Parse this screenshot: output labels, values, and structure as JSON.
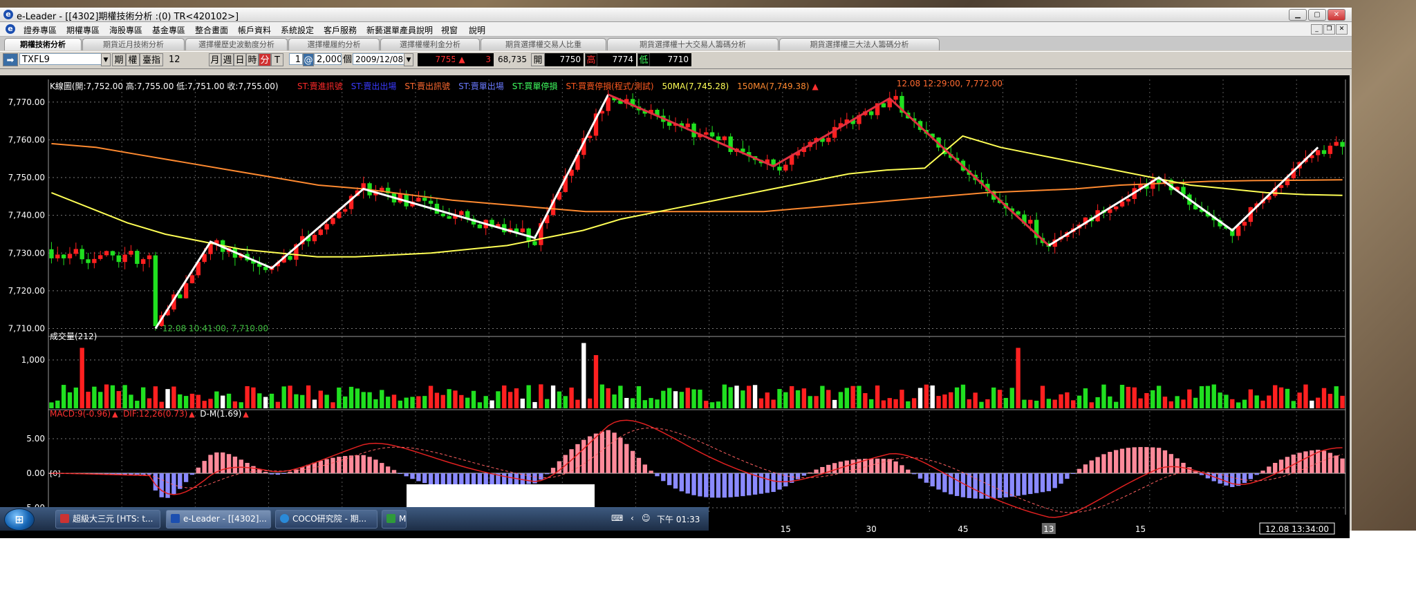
{
  "window": {
    "title": "e-Leader - [[4302]期權技術分析 :(0) TR<420102>]"
  },
  "window_controls": {
    "minimize": "▁",
    "maximize": "▢",
    "close": "✕"
  },
  "menu": {
    "items": [
      "證券專區",
      "期權專區",
      "海股專區",
      "基金專區",
      "整合畫面",
      "帳戶資料",
      "系統設定",
      "客戶服務",
      "新藝選單產員說明",
      "視窗",
      "說明"
    ]
  },
  "mdi_controls": {
    "minimize": "_",
    "restore": "❐",
    "close": "✕"
  },
  "tabs": [
    "期權技術分析",
    "期貨近月技術分析",
    "選擇權歷史波動度分析",
    "選擇權履約分析",
    "選擇權權利金分析",
    "期貨選擇權交易人比重",
    "期貨選擇權十大交易人籌碼分析",
    "期貨選擇權三大法人籌碼分析"
  ],
  "toolbar": {
    "symbol": "TXFL9",
    "btn_futures": "期",
    "btn_options": "權",
    "btn_index": "臺指",
    "period_value": "12",
    "period_month": "月",
    "period_week": "週",
    "period_day": "日",
    "period_hour": "時",
    "period_minute": "分",
    "btn_t": "T",
    "multiplier": "1",
    "at_sign": "@",
    "count": "2,000",
    "count_unit": "個",
    "date": "2009/12/08",
    "last_price": "7755",
    "change_arrow": "▲",
    "change": "3",
    "volume": "68,735",
    "open_label": "開",
    "open": "7750",
    "high_label": "高",
    "high": "7774",
    "low_label": "低",
    "low": "7710"
  },
  "chart_data": [
    {
      "type": "candlestick",
      "title": "K線圖(開:7,752.00 高:7,755.00 低:7,751.00 收:7,755.00)",
      "legend": [
        {
          "label": "ST:賣進訊號",
          "color": "#ff2a2a"
        },
        {
          "label": "ST:賣出出場",
          "color": "#3a3aff"
        },
        {
          "label": "ST:賣出訊號",
          "color": "#ff6a30"
        },
        {
          "label": "ST:賣單出場",
          "color": "#6a7aff"
        },
        {
          "label": "ST:買單停損",
          "color": "#40ff60"
        },
        {
          "label": "ST:買賣停損(程式/測試)",
          "color": "#ff5a20"
        },
        {
          "label": "50MA(7,745.28)",
          "color": "#ffff55"
        },
        {
          "label": "150MA(7,749.38)",
          "color": "#ff8a30"
        }
      ],
      "legend_arrow": "▲",
      "y_ticks": [
        7770,
        7760,
        7750,
        7740,
        7730,
        7720,
        7710
      ],
      "y_tick_labels": [
        "7,770.00",
        "7,760.00",
        "7,750.00",
        "7,740.00",
        "7,730.00",
        "7,720.00",
        "7,710.00"
      ],
      "ylim": [
        7709,
        7776
      ],
      "n_bars": 212,
      "ma50": [
        7746,
        7742,
        7738,
        7735,
        7733,
        7731,
        7730,
        7729,
        7729,
        7729.5,
        7730,
        7731,
        7732,
        7734,
        7736,
        7739,
        7741,
        7743,
        7745,
        7747,
        7749,
        7751,
        7752,
        7752.5,
        7761,
        7758,
        7756,
        7754,
        7752,
        7750,
        7748,
        7747,
        7746,
        7745.5,
        7745.3
      ],
      "ma150": [
        7759,
        7758,
        7756,
        7754,
        7752,
        7750,
        7748,
        7747,
        7745.5,
        7744,
        7743,
        7742,
        7741,
        7741,
        7741,
        7741,
        7741,
        7742,
        7743,
        7744,
        7745,
        7746,
        7746.5,
        7747,
        7748,
        7748.5,
        7749,
        7749.2,
        7749.3,
        7749.4
      ],
      "zigzag": [
        {
          "color": "#ffffff",
          "points": [
            [
              17,
              7710
            ],
            [
              26,
              7733
            ],
            [
              36,
              7726
            ],
            [
              51,
              7747
            ],
            [
              79,
              7734
            ],
            [
              91,
              7772
            ]
          ]
        },
        {
          "color": "#e03040",
          "points": [
            [
              91,
              7772
            ],
            [
              118,
              7753
            ],
            [
              137,
              7771
            ],
            [
              163,
              7732
            ]
          ]
        },
        {
          "color": "#ffffff",
          "points": [
            [
              163,
              7732
            ],
            [
              181,
              7750
            ],
            [
              193,
              7736
            ],
            [
              207,
              7758
            ]
          ]
        }
      ],
      "annotations": [
        {
          "text": "12.08 12:29:00, 7,772.00",
          "x": 137,
          "y": 7772,
          "color": "#ff6a30"
        },
        {
          "text": "12.08 10:41:00, 7,710.00",
          "x": 17,
          "y": 7710,
          "color": "#40c040"
        }
      ]
    },
    {
      "type": "bar",
      "title": "成交量(212)",
      "y_ticks": [
        1000
      ],
      "y_tick_labels": [
        "1,000"
      ],
      "ylim": [
        0,
        1400
      ],
      "spike_bars": [
        {
          "index": 5,
          "value": 1250
        },
        {
          "index": 87,
          "value": 1350
        },
        {
          "index": 89,
          "value": 1100
        },
        {
          "index": 158,
          "value": 1250
        }
      ]
    },
    {
      "type": "bar",
      "title_parts": [
        {
          "text": "MACD:9(-0.96)",
          "color": "#ff3030"
        },
        {
          "text": "DIF:12,26(0.73)",
          "color": "#ff3030"
        },
        {
          "text": "D-M(1.69)",
          "color": "#ffffff"
        }
      ],
      "title_arrow": "▲",
      "zero_label": "[0]",
      "y_ticks": [
        5,
        0,
        -5
      ],
      "y_tick_labels": [
        "5.00",
        "0.00",
        "-5.00"
      ],
      "ylim": [
        -6,
        8
      ]
    }
  ],
  "x_axis": {
    "labels": [
      {
        "text": "15",
        "bar": 120
      },
      {
        "text": "30",
        "bar": 134
      },
      {
        "text": "45",
        "bar": 149
      },
      {
        "text": "13",
        "bar": 163,
        "highlight": true
      },
      {
        "text": "15",
        "bar": 178
      }
    ],
    "cursor_time": "12.08 13:34:00"
  },
  "taskbar": {
    "start_label": "⊞",
    "items": [
      {
        "label": "超級大三元 [HTS: t...",
        "active": false
      },
      {
        "label": "e-Leader - [[4302]...",
        "active": true
      },
      {
        "label": "COCO研究院 - 期...",
        "active": false
      },
      {
        "label": "M",
        "active": false
      }
    ],
    "clock": "下午 01:33"
  }
}
